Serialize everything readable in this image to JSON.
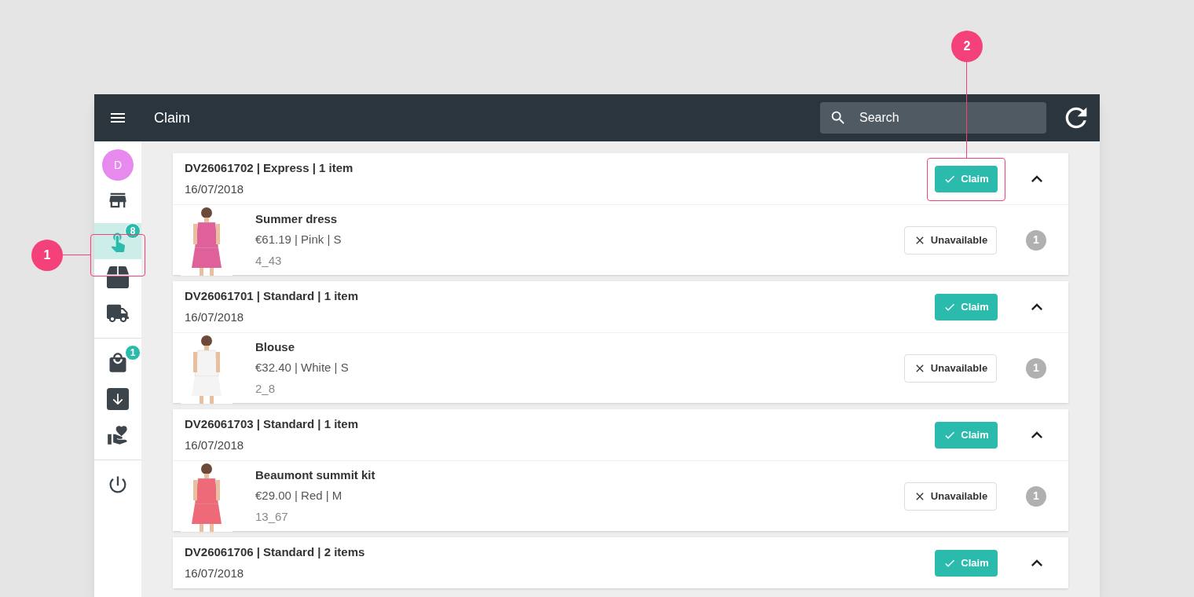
{
  "header": {
    "title": "Claim",
    "search": {
      "placeholder": "Search"
    }
  },
  "sidebar": {
    "avatar": {
      "initial": "D"
    },
    "groups": [
      [
        {
          "selected": false
        },
        {
          "selected": true,
          "badge": "8"
        },
        {
          "selected": false
        },
        {
          "selected": false
        }
      ],
      [
        {
          "selected": false,
          "badge": "1"
        },
        {
          "selected": false
        },
        {
          "selected": false
        }
      ],
      [
        {
          "selected": false
        }
      ]
    ]
  },
  "orders": [
    {
      "title": "DV26061702 | Express | 1 item",
      "date": "16/07/2018",
      "claim": "Claim",
      "expanded": true,
      "items": [
        {
          "name": "Summer dress",
          "details": "€61.19 | Pink | S",
          "code": "4_43",
          "unavailable": "Unavailable",
          "count": "1",
          "color": "#e0609a"
        }
      ]
    },
    {
      "title": "DV26061701 | Standard | 1 item",
      "date": "16/07/2018",
      "claim": "Claim",
      "expanded": true,
      "items": [
        {
          "name": "Blouse",
          "details": "€32.40 | White | S",
          "code": "2_8",
          "unavailable": "Unavailable",
          "count": "1",
          "color": "#f4f4f4"
        }
      ]
    },
    {
      "title": "DV26061703 | Standard | 1 item",
      "date": "16/07/2018",
      "claim": "Claim",
      "expanded": true,
      "items": [
        {
          "name": "Beaumont summit kit",
          "details": "€29.00 | Red | M",
          "code": "13_67",
          "unavailable": "Unavailable",
          "count": "1",
          "color": "#ee6a78"
        }
      ]
    },
    {
      "title": "DV26061706 | Standard | 2 items",
      "date": "16/07/2018",
      "claim": "Claim",
      "expanded": true
    }
  ],
  "callouts": [
    {
      "label": "1"
    },
    {
      "label": "2"
    }
  ]
}
